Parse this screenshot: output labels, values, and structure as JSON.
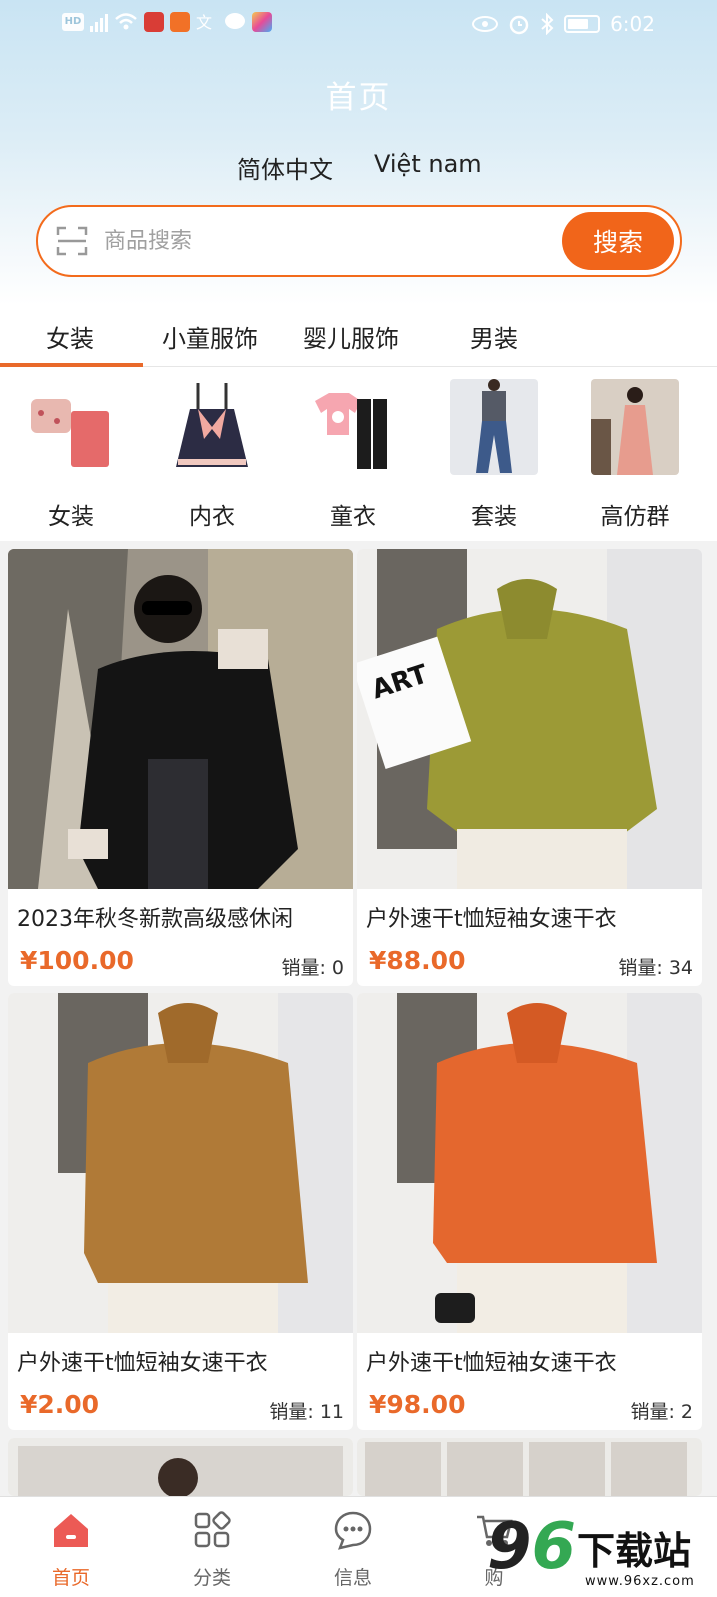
{
  "status_bar": {
    "time": "6:02",
    "hd_label": "HD"
  },
  "header": {
    "title": "首页",
    "languages": [
      "简体中文",
      "Việt nam"
    ],
    "search_placeholder": "商品搜索",
    "search_button": "搜索"
  },
  "tabs": [
    "女装",
    "小童服饰",
    "婴儿服饰",
    "男装"
  ],
  "categories": [
    "女装",
    "内衣",
    "童衣",
    "套装",
    "高仿群"
  ],
  "products": [
    {
      "name": "2023年秋冬新款高级感休闲",
      "price": "¥100.00",
      "sales": "销量: 0"
    },
    {
      "name": "户外速干t恤短袖女速干衣",
      "price": "¥88.00",
      "sales": "销量: 34"
    },
    {
      "name": "户外速干t恤短袖女速干衣",
      "price": "¥2.00",
      "sales": "销量: 11"
    },
    {
      "name": "户外速干t恤短袖女速干衣",
      "price": "¥98.00",
      "sales": "销量: 2"
    }
  ],
  "bottom_nav": [
    "首页",
    "分类",
    "信息",
    "购"
  ],
  "watermark": {
    "text": "下载站",
    "url": "www.96xz.com"
  },
  "colors": {
    "accent": "#e9692a",
    "search_button": "#f1651a",
    "header_top": "#c9e4f3"
  }
}
